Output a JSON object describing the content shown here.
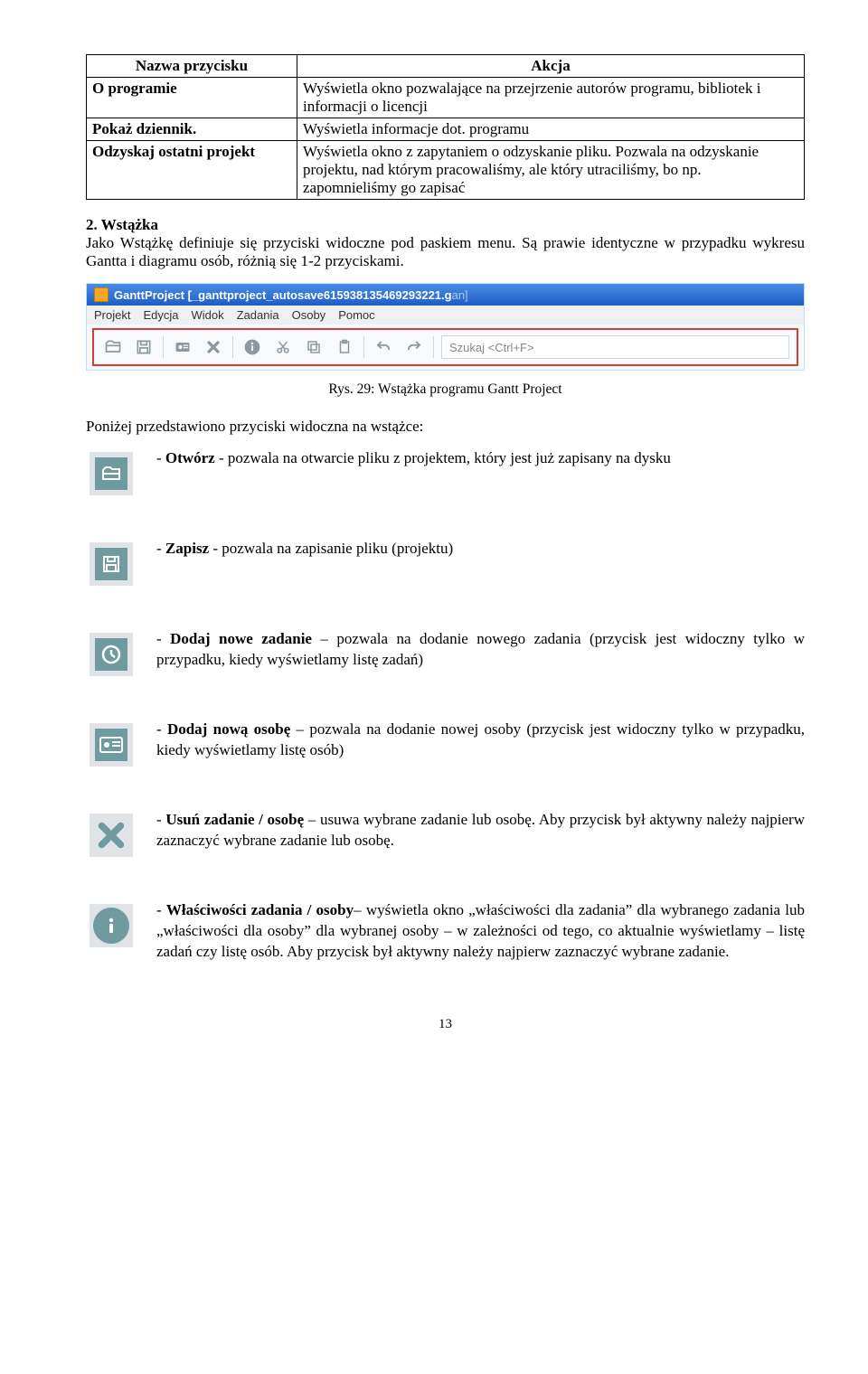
{
  "table": {
    "headers": [
      "Nazwa przycisku",
      "Akcja"
    ],
    "rows": [
      {
        "name": "O programie",
        "action": "Wyświetla okno pozwalające na przejrzenie autorów programu, bibliotek i informacji o licencji"
      },
      {
        "name": "Pokaż dziennik.",
        "action": "Wyświetla informacje dot. programu"
      },
      {
        "name": "Odzyskaj ostatni projekt",
        "action": "Wyświetla okno z zapytaniem o odzyskanie pliku. Pozwala na odzyskanie projektu, nad którym pracowaliśmy, ale który utraciliśmy, bo np. zapomnieliśmy go zapisać"
      }
    ]
  },
  "section": {
    "heading": "2. Wstążka",
    "body": "Jako Wstążkę definiuje się przyciski widoczne pod paskiem menu. Są prawie identyczne w przypadku wykresu Gantta i diagramu osób, różnią się 1-2 przyciskami."
  },
  "screenshot": {
    "title_prefix": "GanttProject [_ganttproject_autosave615938135469293221.g",
    "title_suffix": "an]",
    "menus": [
      "Projekt",
      "Edycja",
      "Widok",
      "Zadania",
      "Osoby",
      "Pomoc"
    ],
    "search_placeholder": "Szukaj <Ctrl+F>"
  },
  "fig_caption": "Rys. 29: Wstążka programu Gantt Project",
  "intro_below": "Poniżej przedstawiono przyciski widoczna na wstążce:",
  "buttons": [
    {
      "lead": "Otwórz",
      "sep": " - ",
      "desc": "pozwala na otwarcie pliku z projektem, który jest już zapisany na dysku"
    },
    {
      "lead": "Zapisz",
      "sep": " - ",
      "desc": "pozwala na zapisanie pliku (projektu)"
    },
    {
      "lead": "Dodaj nowe zadanie",
      "sep": " – ",
      "desc": "pozwala na dodanie nowego zadania (przycisk jest widoczny tylko w przypadku, kiedy wyświetlamy listę zadań)"
    },
    {
      "lead": "Dodaj nową osobę",
      "sep": " – ",
      "desc": "pozwala na dodanie nowej osoby (przycisk jest widoczny tylko w przypadku, kiedy wyświetlamy listę osób)"
    },
    {
      "lead": "Usuń zadanie / osobę",
      "sep": " – ",
      "desc": "usuwa wybrane zadanie lub osobę. Aby przycisk był aktywny należy najpierw zaznaczyć wybrane zadanie lub osobę."
    },
    {
      "lead": "Właściwości zadania / osoby",
      "sep": "– ",
      "desc": "wyświetla okno „właściwości dla zadania” dla wybranego zadania lub „właściwości dla osoby” dla wybranej osoby – w zależności od tego, co aktualnie wyświetlamy – listę zadań czy listę osób. Aby przycisk był aktywny należy najpierw zaznaczyć wybrane zadanie."
    }
  ],
  "page_number": "13"
}
